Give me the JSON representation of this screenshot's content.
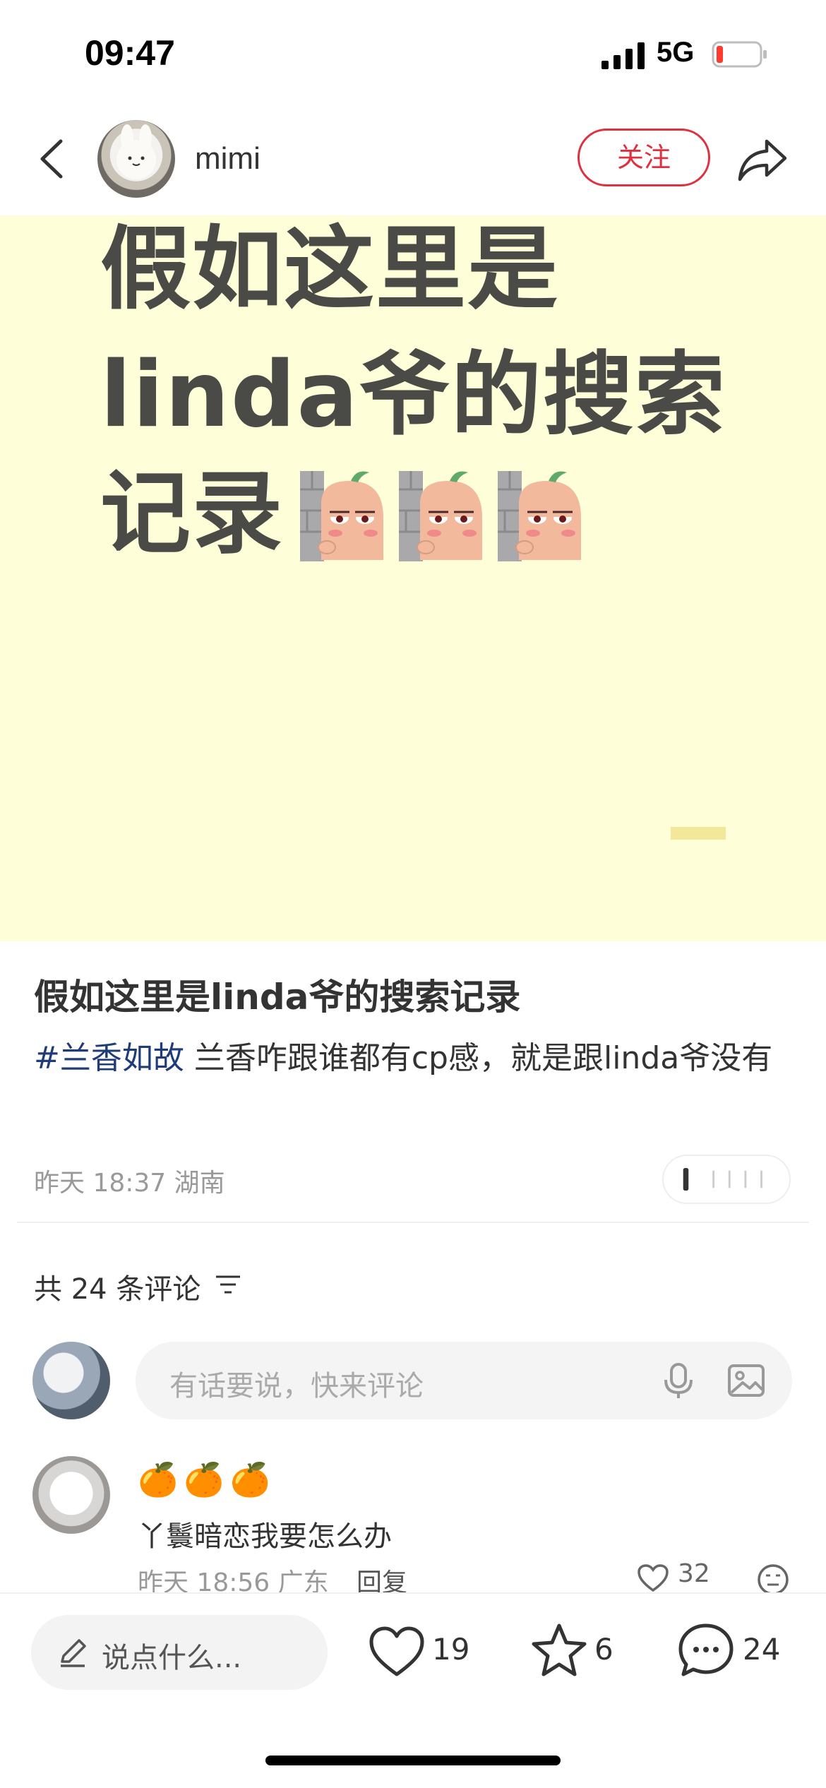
{
  "status_bar": {
    "time": "09:47",
    "network": "5G"
  },
  "header": {
    "author_name": "mimi",
    "follow_label": "关注"
  },
  "image": {
    "lines": [
      "假如这里是",
      "linda爷的搜索",
      "记录"
    ]
  },
  "note": {
    "title": "假如这里是linda爷的搜索记录",
    "tag": "#兰香如故",
    "body": " 兰香咋跟谁都有cp感，就是跟linda爷没有",
    "meta": "昨天 18:37 湖南"
  },
  "comments": {
    "count_label": "共 24 条评论",
    "input_placeholder": "有话要说，快来评论",
    "items": [
      {
        "emojis": "🍊🍊🍊",
        "text": "丫鬟暗恋我要怎么办",
        "meta": "昨天 18:56 广东",
        "reply_label": "回复",
        "likes": "32"
      }
    ]
  },
  "bottom_bar": {
    "say_placeholder": "说点什么...",
    "like_count": "19",
    "star_count": "6",
    "comment_count": "24"
  },
  "colors": {
    "accent": "#e0303f",
    "tag": "#1f3c78",
    "image_bg": "#fefed8"
  }
}
